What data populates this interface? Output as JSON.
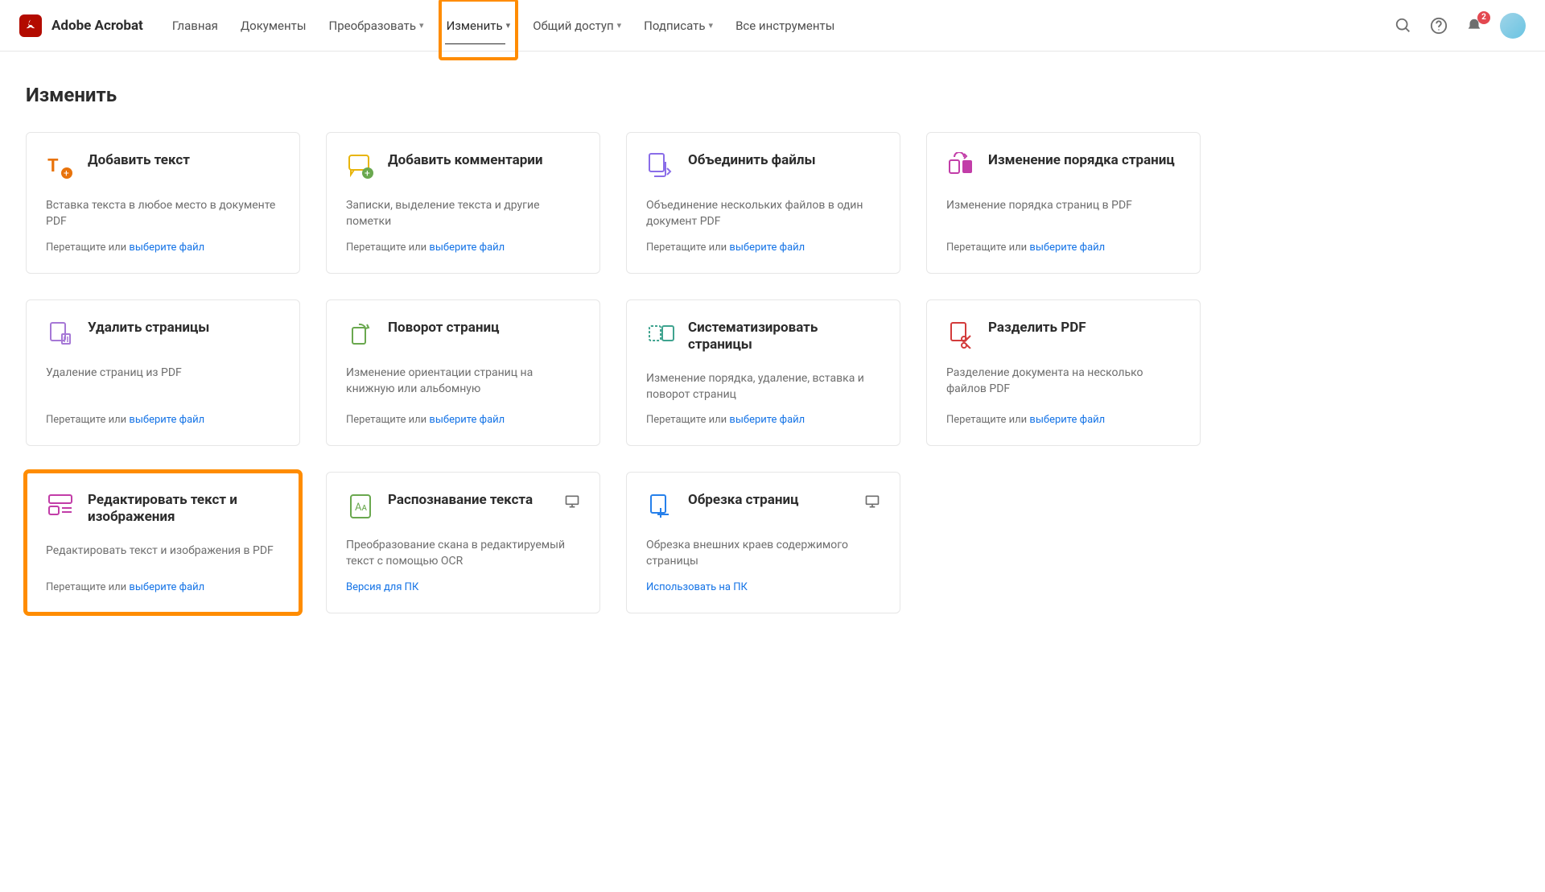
{
  "app": {
    "name": "Adobe Acrobat"
  },
  "nav": {
    "home": "Главная",
    "documents": "Документы",
    "convert": "Преобразовать",
    "edit": "Изменить",
    "share": "Общий доступ",
    "sign": "Подписать",
    "all_tools": "Все инструменты"
  },
  "notifications": {
    "count": "2"
  },
  "page": {
    "title": "Изменить"
  },
  "common": {
    "drag_prefix": "Перетащите или ",
    "select_file": "выберите файл"
  },
  "cards": {
    "add_text": {
      "title": "Добавить текст",
      "desc": "Вставка текста в любое место в документе PDF"
    },
    "add_comments": {
      "title": "Добавить комментарии",
      "desc": "Записки, выделение текста и другие пометки"
    },
    "combine_files": {
      "title": "Объединить файлы",
      "desc": "Объединение нескольких файлов в один документ PDF"
    },
    "reorder_pages": {
      "title": "Изменение порядка страниц",
      "desc": "Изменение порядка страниц в PDF"
    },
    "delete_pages": {
      "title": "Удалить страницы",
      "desc": "Удаление страниц из PDF"
    },
    "rotate_pages": {
      "title": "Поворот страниц",
      "desc": "Изменение ориентации страниц на книжную или альбомную"
    },
    "organize_pages": {
      "title": "Систематизировать страницы",
      "desc": "Изменение порядка, удаление, вставка и поворот страниц"
    },
    "split_pdf": {
      "title": "Разделить PDF",
      "desc": "Разделение документа на несколько файлов PDF"
    },
    "edit_text_img": {
      "title": "Редактировать текст и изображения",
      "desc": "Редактировать текст и изображения в PDF"
    },
    "ocr": {
      "title": "Распознавание текста",
      "desc": "Преобразование скана в редактируемый текст с помощью OCR",
      "action": "Версия для ПК"
    },
    "crop_pages": {
      "title": "Обрезка страниц",
      "desc": "Обрезка внешних краев содержимого страницы",
      "action": "Использовать на ПК"
    }
  }
}
